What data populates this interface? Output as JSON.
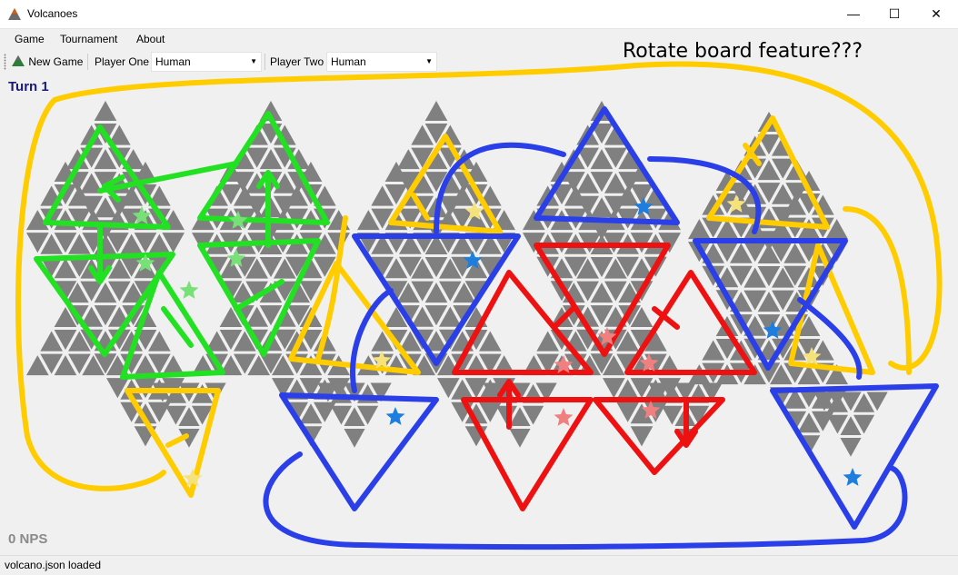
{
  "window": {
    "title": "Volcanoes",
    "minimize_glyph": "—",
    "maximize_glyph": "☐",
    "close_glyph": "✕"
  },
  "menu": {
    "game_label": "Game",
    "tournament_label": "Tournament",
    "about_label": "About"
  },
  "toolbar": {
    "new_game_label": "New Game",
    "player_one_label": "Player One",
    "player_one_value": "Human",
    "player_two_label": "Player Two",
    "player_two_value": "Human"
  },
  "board": {
    "turn_text": "Turn 1",
    "nps_text": "0 NPS",
    "annotation_text": "Rotate board feature???",
    "tile_color": "#808080",
    "background_color": "#f0f0f0",
    "overlay_colors": {
      "green": "#22e022",
      "yellow": "#ffcc00",
      "blue": "#2a3fe8",
      "red": "#ee1111"
    },
    "star_colors": {
      "green": "#77e077",
      "yellow": "#f5e27a",
      "blue": "#1e7ee0",
      "red": "#f08080"
    }
  },
  "status": {
    "message": "volcano.json loaded"
  }
}
